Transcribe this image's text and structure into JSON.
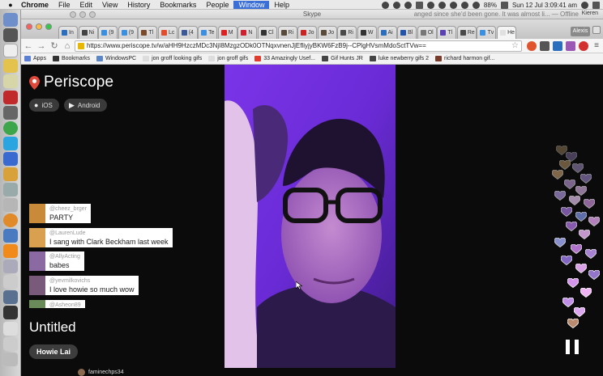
{
  "menubar": {
    "app": "Chrome",
    "items": [
      "File",
      "Edit",
      "View",
      "History",
      "Bookmarks",
      "People",
      "Window",
      "Help"
    ],
    "active_item": "Window",
    "battery": "88%",
    "clock": "Sun 12 Jul  3:09:41 am"
  },
  "skype": {
    "title": "Skype",
    "status_line": "anged since she'd been gone. It was almost li... — Offline",
    "user": "Kieren"
  },
  "chrome": {
    "tabs": [
      {
        "label": "In",
        "color": "#2a6ebd"
      },
      {
        "label": "Ni",
        "color": "#444444"
      },
      {
        "label": "(9",
        "color": "#3b8fe0"
      },
      {
        "label": "(9",
        "color": "#3b8fe0"
      },
      {
        "label": "Tl",
        "color": "#7a4a2a"
      },
      {
        "label": "Lc",
        "color": "#e24c2c"
      },
      {
        "label": "(4",
        "color": "#3b5998"
      },
      {
        "label": "Te",
        "color": "#3b8fe0"
      },
      {
        "label": "M",
        "color": "#e02020"
      },
      {
        "label": "N",
        "color": "#d01f2f"
      },
      {
        "label": "Cl",
        "color": "#333333"
      },
      {
        "label": "Ri",
        "color": "#5a4a3a"
      },
      {
        "label": "Jo",
        "color": "#cc2222"
      },
      {
        "label": "Jo",
        "color": "#5a4a3a"
      },
      {
        "label": "Ri",
        "color": "#4a4a4a"
      },
      {
        "label": "W",
        "color": "#333333"
      },
      {
        "label": "Ai",
        "color": "#2a6ebd"
      },
      {
        "label": "Bl",
        "color": "#2255aa"
      },
      {
        "label": "Ol",
        "color": "#777777"
      },
      {
        "label": "Tl",
        "color": "#5a3fb5"
      },
      {
        "label": "Re",
        "color": "#4a4a4a"
      },
      {
        "label": "Tv",
        "color": "#3b8fe0"
      },
      {
        "label": "He",
        "color": "#e0e0e0"
      }
    ],
    "profile_button": "Alexis",
    "url": "https://www.periscope.tv/w/aHH9HzczMDc3NjI8MzgzODk0OTNqxvnenJjEfliyjyBKW6FzB9j--CPlgHVsmMdoSctTVw==",
    "bookmarks": [
      {
        "label": "Apps",
        "color": "#5a7fd4"
      },
      {
        "label": "Bookmarks",
        "color": "#333333"
      },
      {
        "label": "WindowsPC",
        "color": "#5b86c7"
      },
      {
        "label": "jon groff looking gifs",
        "color": "#dddddd"
      },
      {
        "label": "jon groff gifs",
        "color": "#dddddd"
      },
      {
        "label": "33 Amazingly Usef...",
        "color": "#e03b2f"
      },
      {
        "label": "Gif Hunts JR",
        "color": "#444444"
      },
      {
        "label": "luke newberry gifs 2",
        "color": "#444444"
      },
      {
        "label": "richard harmon gif...",
        "color": "#7a3a2a"
      }
    ]
  },
  "periscope": {
    "brand": "Periscope",
    "store_buttons": [
      {
        "icon": "apple-icon",
        "label": "iOS"
      },
      {
        "icon": "play-icon",
        "label": "Android"
      }
    ],
    "comments": [
      {
        "user": "@cheez_brger",
        "message": "PARTY",
        "avatar_color": "#c98a3a"
      },
      {
        "user": "@LaurenLude",
        "message": "I sang with Clark Beckham last week",
        "avatar_color": "#d9a050"
      },
      {
        "user": "@AllyActing",
        "message": "babes",
        "avatar_color": "#8a6aa0"
      },
      {
        "user": "@yevmilkovichs",
        "message": "I love howie so much wow",
        "avatar_color": "#7a5a7a"
      },
      {
        "user": "@Asheon89",
        "message": "",
        "avatar_color": "#6a8a5a"
      }
    ],
    "broadcast_title": "Untitled",
    "host": "Howie Lai",
    "accent_color": "#e0483c"
  },
  "taskbar": {
    "user": "faminechps34"
  }
}
